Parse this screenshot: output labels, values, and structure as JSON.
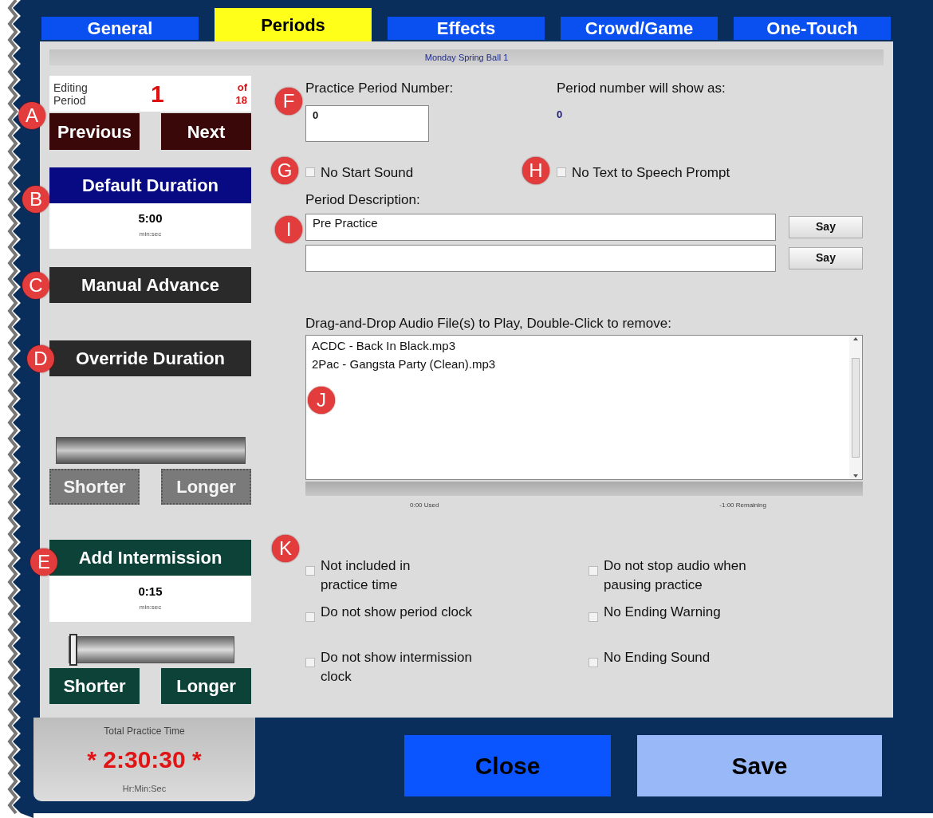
{
  "tabs": [
    {
      "label": "General",
      "selected": false
    },
    {
      "label": "Periods",
      "selected": true
    },
    {
      "label": "Effects",
      "selected": false
    },
    {
      "label": "Crowd/Game",
      "selected": false
    },
    {
      "label": "One-Touch",
      "selected": false
    }
  ],
  "schedule_title": "Monday Spring Ball 1",
  "period_nav": {
    "editing_label": "Editing Period",
    "current": "1",
    "of_label": "of",
    "total": "18",
    "buttons": [
      "Previous",
      "Next"
    ]
  },
  "default_duration": {
    "title": "Default Duration",
    "time": "5:00",
    "unit": "min:sec"
  },
  "manual_advance": {
    "label": "Manual Advance"
  },
  "override_duration": {
    "label": "Override Duration",
    "slider": {
      "disabled": true
    },
    "buttons": [
      {
        "label": "Shorter",
        "disabled": true
      },
      {
        "label": "Longer",
        "disabled": true
      }
    ]
  },
  "intermission": {
    "title": "Add Intermission",
    "time": "0:15",
    "unit": "min:sec",
    "slider": {
      "disabled": false,
      "level": 0
    },
    "buttons": [
      {
        "label": "Shorter",
        "disabled": false
      },
      {
        "label": "Longer",
        "disabled": false
      }
    ]
  },
  "total_practice": {
    "label": "Total Practice Time",
    "time": "* 2:30:30 *",
    "unit": "Hr:Min:Sec"
  },
  "period_number": {
    "label": "Practice Period Number:",
    "value": "0",
    "preview_label": "Period number will show as:",
    "preview": "0"
  },
  "options_top": [
    {
      "label": "No Start Sound",
      "checked": false
    },
    {
      "label": "No Text to Speech Prompt",
      "checked": false
    }
  ],
  "description": {
    "label": "Period Description:",
    "lines": [
      {
        "value": "Pre Practice",
        "button": "Say"
      },
      {
        "button": "Say"
      }
    ]
  },
  "audio": {
    "label": "Drag-and-Drop Audio File(s) to Play, Double-Click to remove:",
    "files": [
      "ACDC - Back In Black.mp3",
      "2Pac - Gangsta Party (Clean).mp3"
    ],
    "used": "0:00 Used",
    "remaining": "-1:00 Remaining"
  },
  "options": [
    {
      "label": "Not included in\npractice time",
      "checked": false
    },
    {
      "label": "Do not stop audio when\npausing practice",
      "checked": false
    },
    {
      "label": "Do not show period clock",
      "checked": false
    },
    {
      "label": "No Ending Warning",
      "checked": false
    },
    {
      "label": "Do not show intermission\nclock",
      "checked": false
    },
    {
      "label": "No Ending Sound",
      "checked": false
    }
  ],
  "buttons": [
    {
      "label": "Close",
      "kind": "close"
    },
    {
      "label": "Save",
      "kind": "save"
    }
  ],
  "callouts": [
    "A",
    "B",
    "C",
    "D",
    "E",
    "F",
    "G",
    "H",
    "I",
    "J",
    "K"
  ]
}
